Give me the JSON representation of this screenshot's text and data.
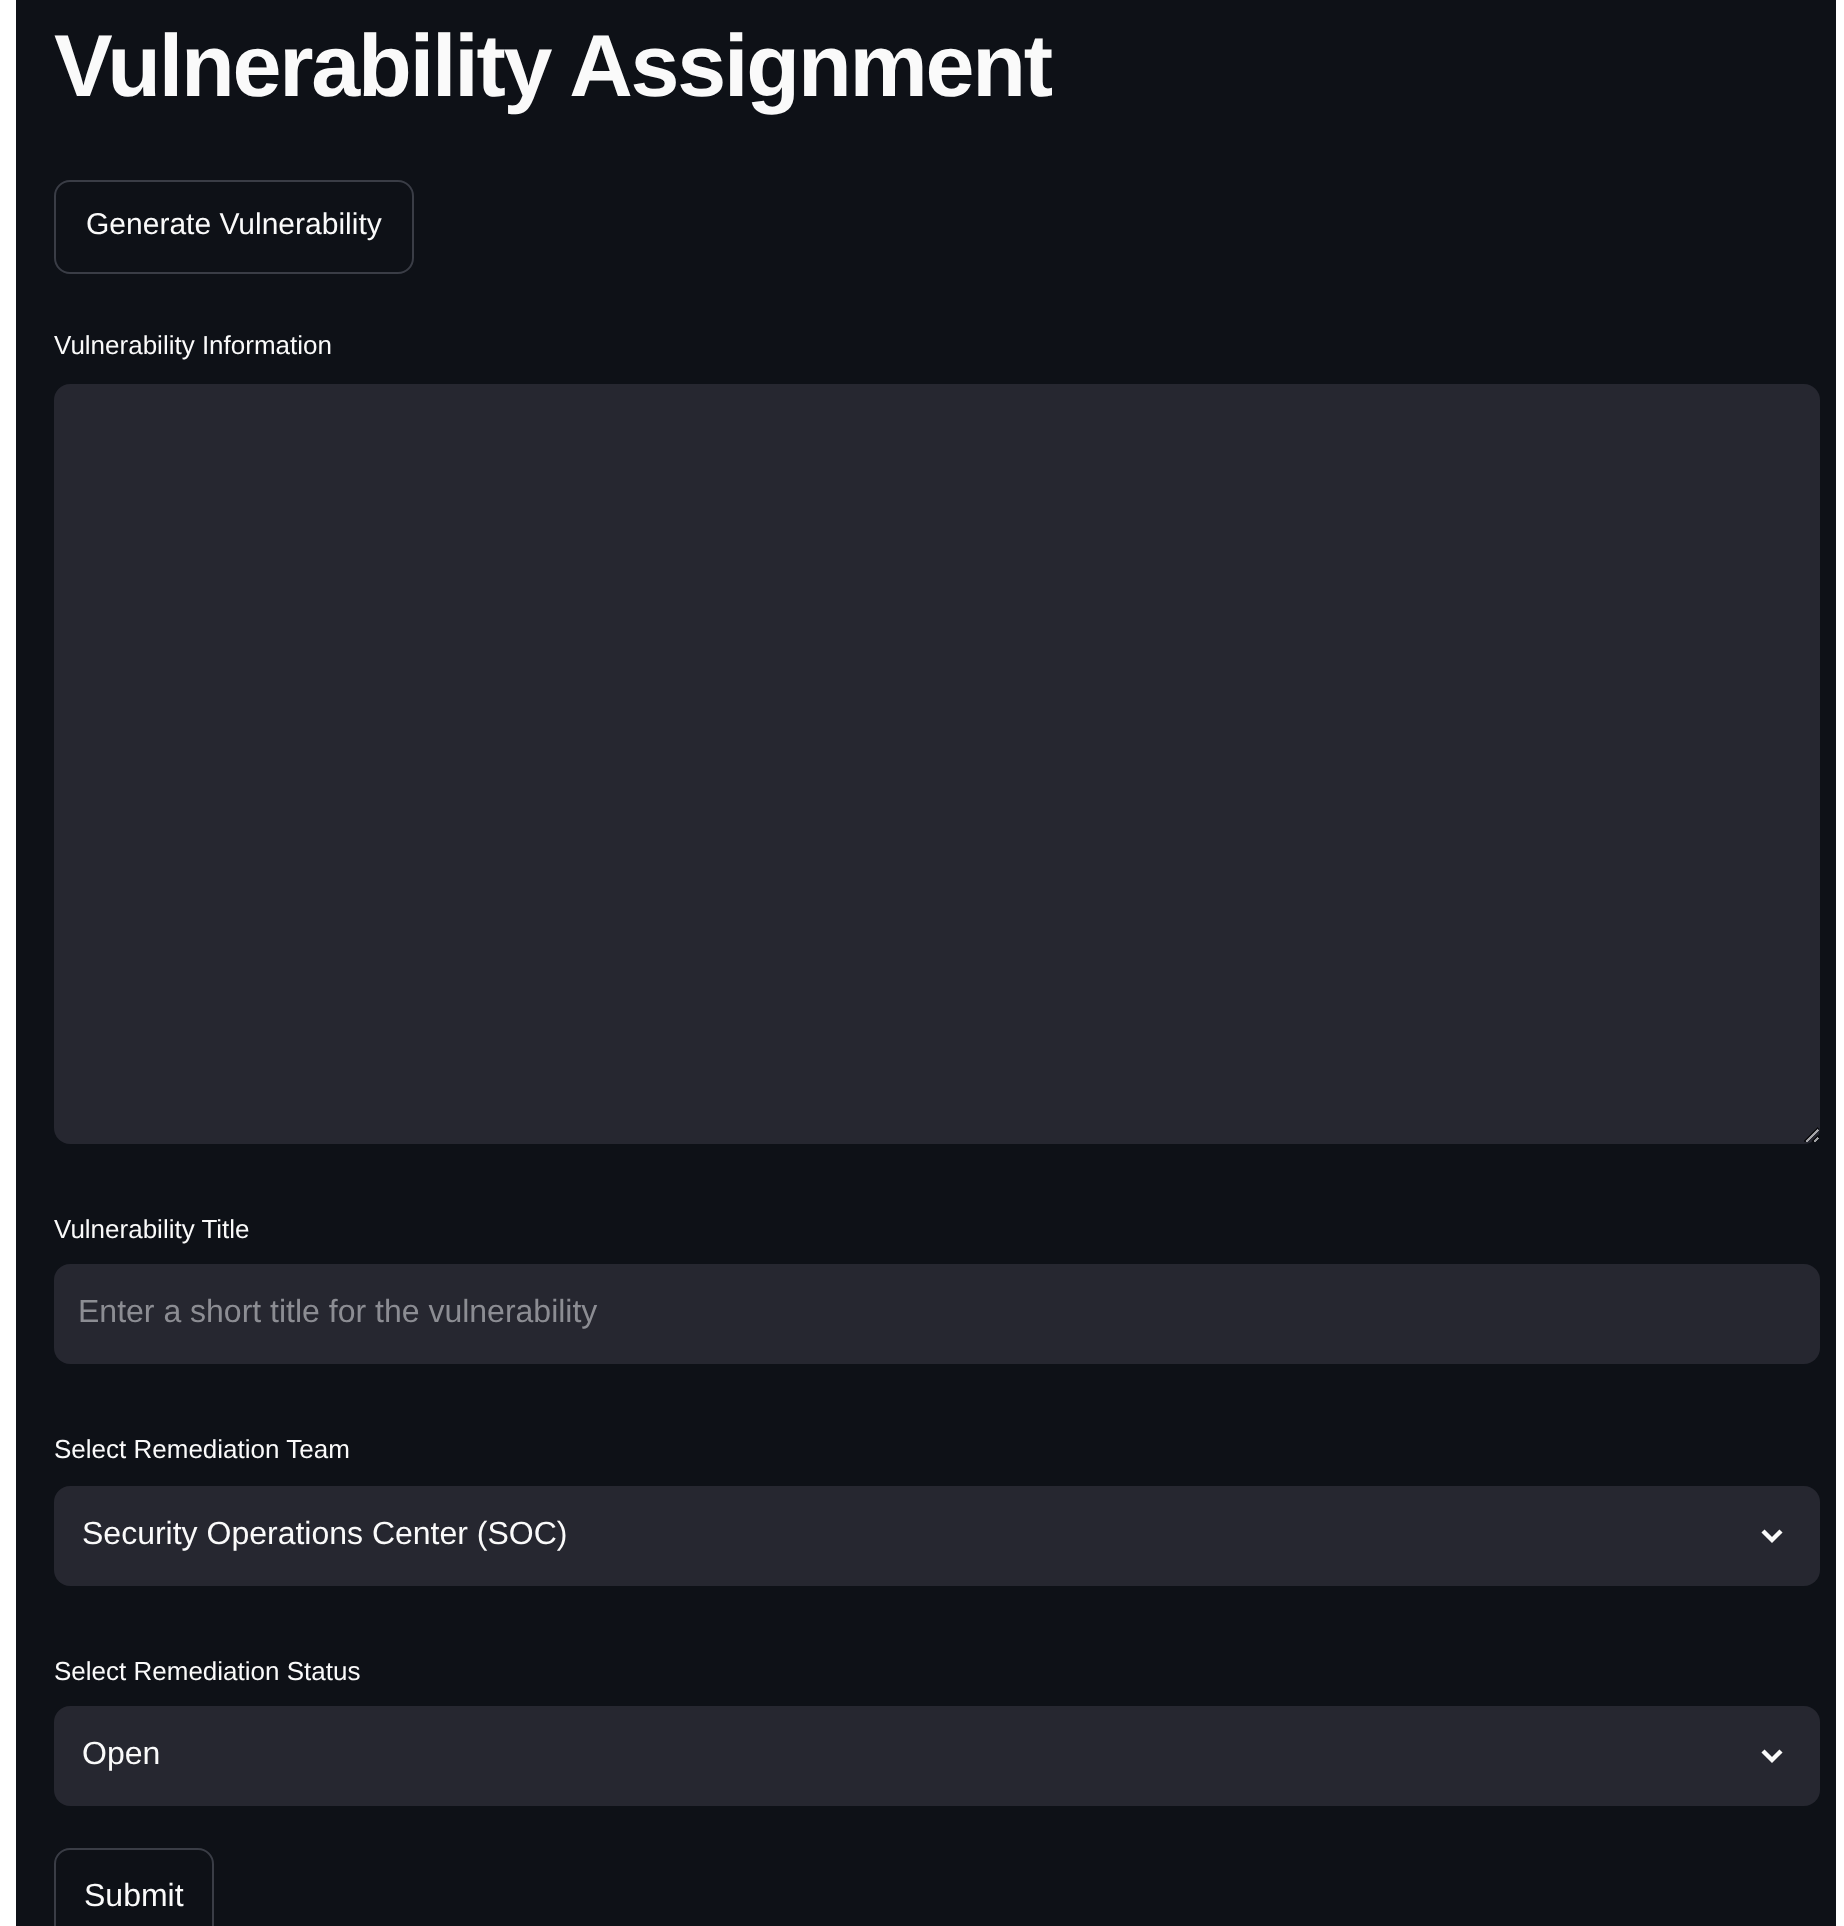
{
  "title": "Vulnerability Assignment",
  "generate_button": "Generate Vulnerability",
  "fields": [
    {
      "kind": "textarea",
      "label": "Vulnerability Information"
    },
    {
      "kind": "text",
      "label": "Vulnerability Title",
      "placeholder": "Enter a short title for the vulnerability"
    },
    {
      "kind": "select",
      "label": "Select Remediation Team",
      "value": "Security Operations Center (SOC)"
    },
    {
      "kind": "select",
      "label": "Select Remediation Status",
      "value": "Open"
    }
  ],
  "submit_button": "Submit"
}
